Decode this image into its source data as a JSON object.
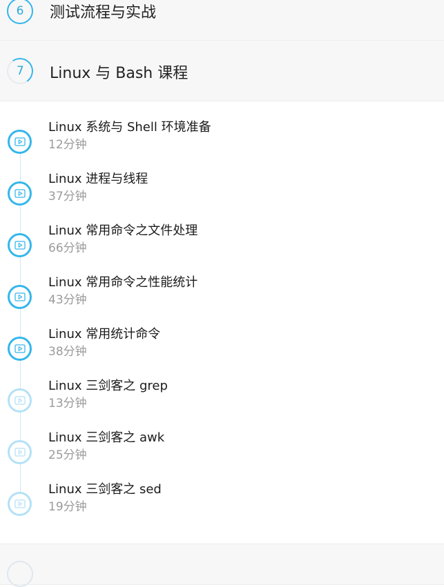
{
  "sections": [
    {
      "number": "6",
      "title": "测试流程与实战"
    },
    {
      "number": "7",
      "title": "Linux 与 Bash 课程"
    }
  ],
  "lessons": [
    {
      "title": "Linux 系统与 Shell 环境准备",
      "duration": "12分钟",
      "style": "active"
    },
    {
      "title": "Linux 进程与线程",
      "duration": "37分钟",
      "style": "active"
    },
    {
      "title": "Linux 常用命令之文件处理",
      "duration": "66分钟",
      "style": "active"
    },
    {
      "title": "Linux 常用命令之性能统计",
      "duration": "43分钟",
      "style": "active"
    },
    {
      "title": "Linux 常用统计命令",
      "duration": "38分钟",
      "style": "active"
    },
    {
      "title": "Linux 三剑客之 grep",
      "duration": "13分钟",
      "style": "inactive"
    },
    {
      "title": "Linux 三剑客之 awk",
      "duration": "25分钟",
      "style": "inactive"
    },
    {
      "title": "Linux 三剑客之 sed",
      "duration": "19分钟",
      "style": "inactive"
    }
  ],
  "colors": {
    "accent": "#33b6ec",
    "accent_light": "#b3e1f6",
    "section_bg": "#f7f7f7",
    "duration_text": "#9a9a9a"
  },
  "icons": {
    "lesson": "video-play-icon"
  }
}
